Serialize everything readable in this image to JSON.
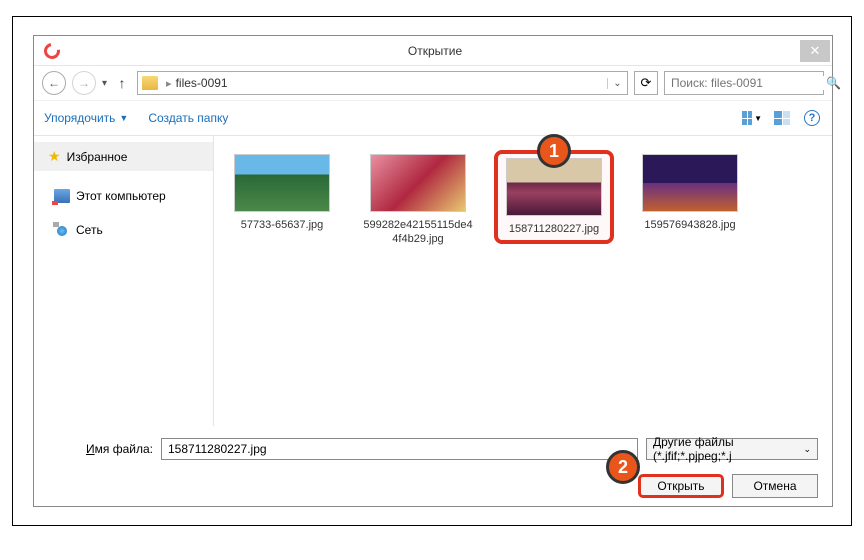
{
  "title": "Открытие",
  "nav": {
    "folder": "files-0091"
  },
  "search": {
    "placeholder": "Поиск: files-0091"
  },
  "toolbar": {
    "organize": "Упорядочить",
    "new_folder": "Создать папку"
  },
  "sidebar": {
    "favorites": "Избранное",
    "this_pc": "Этот компьютер",
    "network": "Сеть"
  },
  "files": [
    {
      "name": "57733-65637.jpg"
    },
    {
      "name": "599282e42155115de44f4b29.jpg"
    },
    {
      "name": "158711280227.jpg"
    },
    {
      "name": "159576943828.jpg"
    }
  ],
  "footer": {
    "filename_label_pre": "И",
    "filename_label_post": "мя файла:",
    "filename_value": "158711280227.jpg",
    "filter": "Другие файлы (*.jfif;*.pjpeg;*.j",
    "open": "Открыть",
    "cancel": "Отмена"
  },
  "markers": {
    "one": "1",
    "two": "2"
  }
}
